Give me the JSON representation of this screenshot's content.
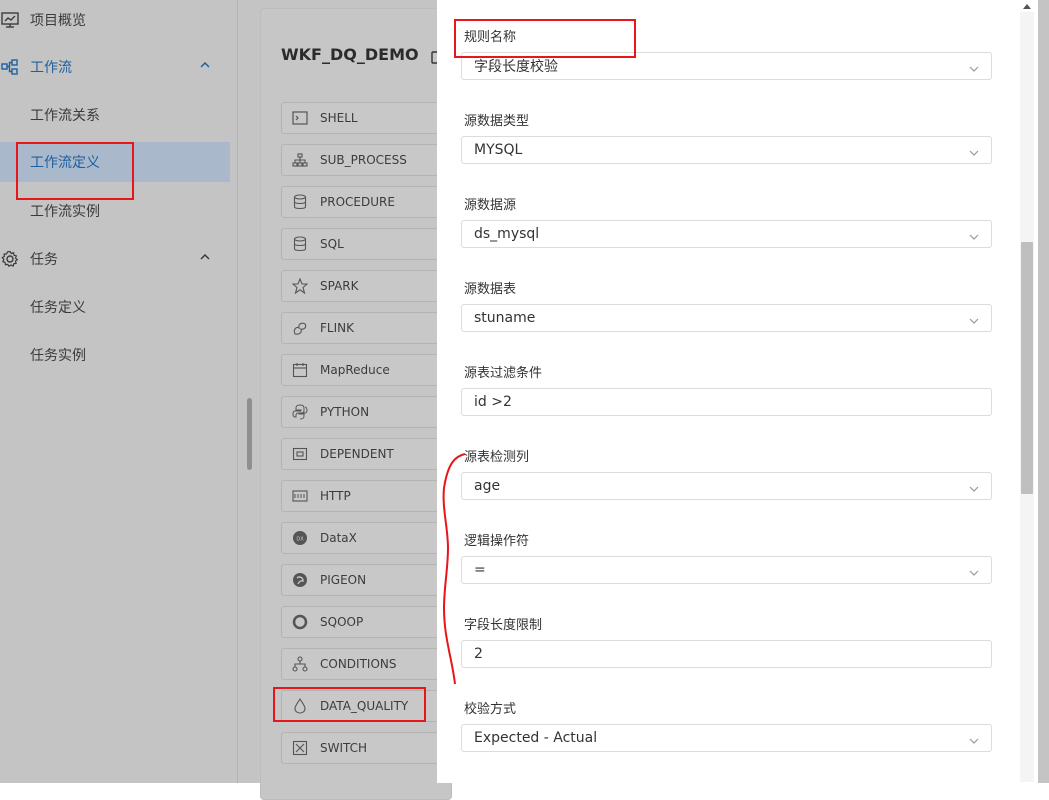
{
  "sidebar": {
    "items": [
      {
        "label": "项目概览",
        "icon": "monitor-chart-icon"
      },
      {
        "label": "工作流",
        "icon": "workflow-icon"
      },
      {
        "label": "工作流关系"
      },
      {
        "label": "工作流定义"
      },
      {
        "label": "工作流实例"
      },
      {
        "label": "任务",
        "icon": "gear-icon"
      },
      {
        "label": "任务定义"
      },
      {
        "label": "任务实例"
      }
    ]
  },
  "workflow": {
    "name": "WKF_DQ_DEMO"
  },
  "task_types": [
    {
      "label": "SHELL",
      "icon": "terminal-icon"
    },
    {
      "label": "SUB_PROCESS",
      "icon": "sitemap-icon"
    },
    {
      "label": "PROCEDURE",
      "icon": "database-icon"
    },
    {
      "label": "SQL",
      "icon": "database-icon"
    },
    {
      "label": "SPARK",
      "icon": "star-icon"
    },
    {
      "label": "FLINK",
      "icon": "squirrel-icon"
    },
    {
      "label": "MapReduce",
      "icon": "calendar-icon"
    },
    {
      "label": "PYTHON",
      "icon": "python-icon"
    },
    {
      "label": "DEPENDENT",
      "icon": "dependent-icon"
    },
    {
      "label": "HTTP",
      "icon": "http-icon"
    },
    {
      "label": "DataX",
      "icon": "datax-icon"
    },
    {
      "label": "PIGEON",
      "icon": "pigeon-icon"
    },
    {
      "label": "SQOOP",
      "icon": "ring-icon"
    },
    {
      "label": "CONDITIONS",
      "icon": "conditions-icon"
    },
    {
      "label": "DATA_QUALITY",
      "icon": "drop-icon"
    },
    {
      "label": "SWITCH",
      "icon": "switch-icon"
    }
  ],
  "form": {
    "rule_name": {
      "label": "规则名称",
      "value": "字段长度校验"
    },
    "source_type": {
      "label": "源数据类型",
      "value": "MYSQL"
    },
    "source_datasource": {
      "label": "源数据源",
      "value": "ds_mysql"
    },
    "source_table": {
      "label": "源数据表",
      "value": "stuname"
    },
    "source_filter": {
      "label": "源表过滤条件",
      "value": "id >2"
    },
    "source_column": {
      "label": "源表检测列",
      "value": "age"
    },
    "logic_operator": {
      "label": "逻辑操作符",
      "value": "="
    },
    "field_length": {
      "label": "字段长度限制",
      "value": "2"
    },
    "check_type": {
      "label": "校验方式",
      "value": "Expected - Actual"
    }
  },
  "colors": {
    "annotation": "#e8151b",
    "active_link": "#1f5f9e"
  }
}
